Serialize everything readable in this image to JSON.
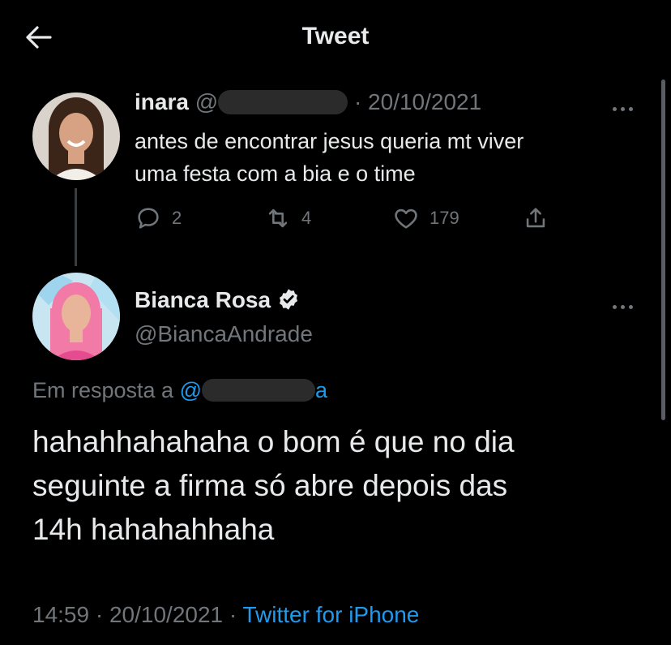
{
  "header": {
    "title": "Tweet"
  },
  "parent_tweet": {
    "name": "inara",
    "handle_prefix": "@",
    "separator": "·",
    "date": "20/10/2021",
    "text_line1": "antes de encontrar jesus queria mt viver",
    "text_line2": "uma festa com a bia e o time",
    "replies": "2",
    "retweets": "4",
    "likes": "179"
  },
  "main_tweet": {
    "name": "Bianca Rosa",
    "handle": "@BiancaAndrade",
    "reply_to_label": "Em resposta a",
    "reply_to_handle_prefix": "@",
    "reply_to_handle_suffix": "a",
    "text_line1": "hahahhahahaha o bom é que no dia",
    "text_line2": "seguinte a firma só abre depois das",
    "text_line3": "14h hahahahhaha",
    "time": "14:59",
    "separator1": "·",
    "date": "20/10/2021",
    "separator2": "·",
    "source": "Twitter for iPhone"
  },
  "colors": {
    "background": "#000000",
    "text": "#e7e9ea",
    "muted": "#71767b",
    "link": "#1d9bf0"
  },
  "icons": [
    "back-arrow-icon",
    "more-options-icon",
    "reply-icon",
    "retweet-icon",
    "like-icon",
    "share-icon",
    "verified-badge-icon"
  ]
}
